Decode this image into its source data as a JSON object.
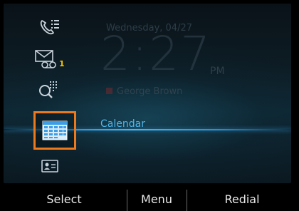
{
  "home": {
    "date": "Wednesday, 04/27",
    "time": "2:27",
    "ampm": "PM",
    "contact_name": "George Brown"
  },
  "nav": {
    "items": [
      {
        "icon": "call-history-icon"
      },
      {
        "icon": "voicemail-icon",
        "badge": "1"
      },
      {
        "icon": "directory-search-icon"
      },
      {
        "icon": "calendar-icon",
        "label": "Calendar",
        "selected": true
      },
      {
        "icon": "contact-card-icon"
      }
    ]
  },
  "softkeys": {
    "left": "Select",
    "middle": "Menu",
    "right": "Redial"
  },
  "colors": {
    "accent_blue": "#4fb6ec",
    "selection_orange": "#ec7a1c",
    "badge_yellow": "#f4c400"
  }
}
